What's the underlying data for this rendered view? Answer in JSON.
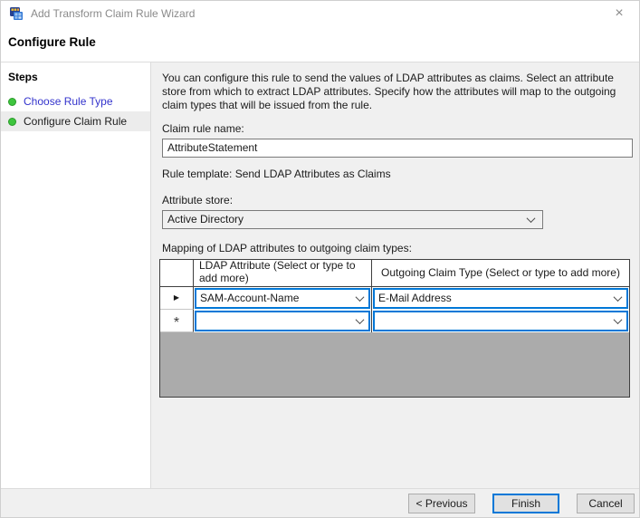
{
  "window": {
    "title": "Add Transform Claim Rule Wizard",
    "close_glyph": "×"
  },
  "heading": "Configure Rule",
  "sidebar": {
    "heading": "Steps",
    "items": [
      {
        "label": "Choose Rule Type"
      },
      {
        "label": "Configure Claim Rule"
      }
    ]
  },
  "content": {
    "description": "You can configure this rule to send the values of LDAP attributes as claims. Select an attribute store from which to extract LDAP attributes. Specify how the attributes will map to the outgoing claim types that will be issued from the rule.",
    "claim_rule_name_label": "Claim rule name:",
    "claim_rule_name_value": "AttributeStatement",
    "rule_template": "Rule template: Send LDAP Attributes as Claims",
    "attribute_store_label": "Attribute store:",
    "attribute_store_value": "Active Directory",
    "mapping_label": "Mapping of LDAP attributes to outgoing claim types:",
    "grid": {
      "columns": {
        "ldap": "LDAP Attribute (Select or type to add more)",
        "outgoing": "Outgoing Claim Type (Select or type to add more)"
      },
      "rows": [
        {
          "marker": "▶",
          "ldap": "SAM-Account-Name",
          "outgoing": "E-Mail Address"
        },
        {
          "marker": "*",
          "ldap": "",
          "outgoing": ""
        }
      ]
    }
  },
  "footer": {
    "previous": "< Previous",
    "finish": "Finish",
    "cancel": "Cancel"
  },
  "colors": {
    "accent_blue": "#0078d7",
    "link_blue": "#3333cc",
    "step_dot_green": "#3ec53e",
    "grid_empty_gray": "#ababab",
    "content_bg": "#f0f0f0",
    "button_bg": "#e1e1e1",
    "button_border": "#adadad"
  }
}
